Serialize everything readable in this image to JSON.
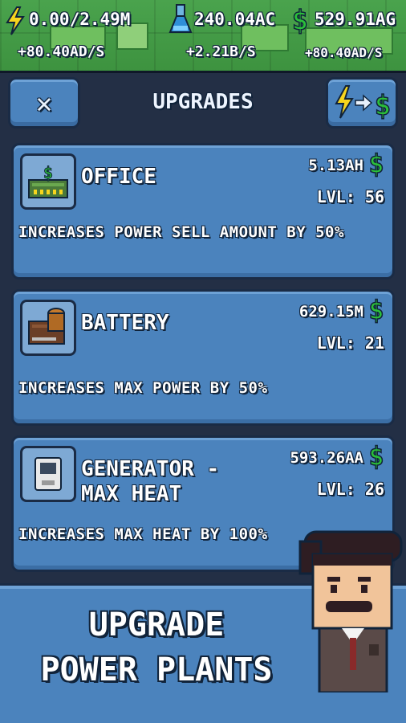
{
  "hud": {
    "power": "0.00/2.49M",
    "research": "240.04AC",
    "money": "529.91AG",
    "power_rate": "+80.40AD/s",
    "research_rate": "+2.21B/s",
    "money_rate": "+80.40AD/s",
    "icons": [
      "lightning-icon",
      "research-flask-icon",
      "dollar-icon"
    ]
  },
  "header": {
    "title": "UPGRADES",
    "close_icon": "close-x-icon",
    "convert_icon": "power-to-money-icon"
  },
  "upgrades": [
    {
      "name": "OFFICE",
      "name_line2": "",
      "cost": "5.13AH",
      "level": "LVL: 56",
      "description": "INCREASES POWER SELL AMOUNT BY 50%",
      "icon": "office-icon"
    },
    {
      "name": "BATTERY",
      "name_line2": "",
      "cost": "629.15M",
      "level": "LVL: 21",
      "description": "INCREASES MAX POWER BY 50%",
      "icon": "battery-icon"
    },
    {
      "name": "GENERATOR -",
      "name_line2": "MAX HEAT",
      "cost": "593.26AA",
      "level": "LVL: 26",
      "description": "INCREASES MAX HEAT BY 100%",
      "icon": "generator-icon"
    }
  ],
  "banner": {
    "line1": "UPGRADE",
    "line2": "POWER PLANTS"
  },
  "colors": {
    "panel_bg": "#232f45",
    "card_bg": "#4b83bd",
    "icon_box": "#7ea9d4",
    "money_green": "#2bbf3a",
    "lightning_yellow": "#f7d51d"
  }
}
